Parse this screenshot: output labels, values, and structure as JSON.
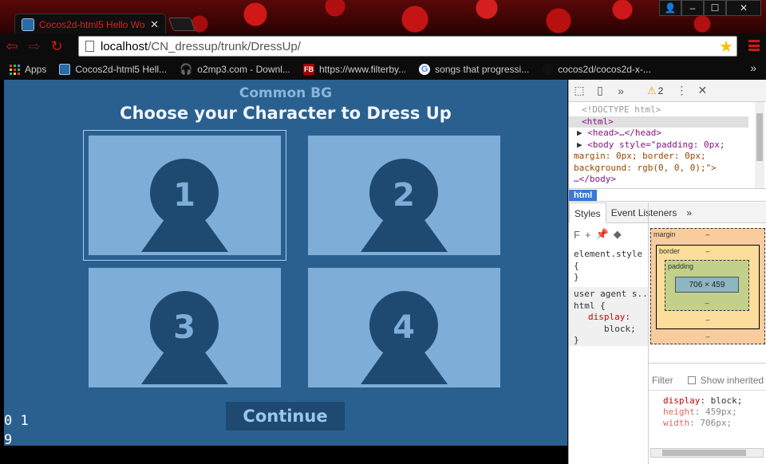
{
  "browser": {
    "tab": {
      "title": "Cocos2d-html5 Hello Wo"
    },
    "url": {
      "host": "localhost",
      "path": "/CN_dressup/trunk/DressUp/"
    },
    "bookmarks": [
      {
        "label": "Apps",
        "icon": "apps-grid-icon"
      },
      {
        "label": "Cocos2d-html5 Hell...",
        "icon": "cocos-icon"
      },
      {
        "label": "o2mp3.com - Downl...",
        "icon": "headphones-icon"
      },
      {
        "label": "https://www.filterby...",
        "icon": "fb-icon"
      },
      {
        "label": "songs that progressi...",
        "icon": "google-icon"
      },
      {
        "label": "cocos2d/cocos2d-x-...",
        "icon": "github-icon"
      }
    ],
    "bookmarks_more": "»"
  },
  "game": {
    "subtitle": "Common BG",
    "title": "Choose your Character to Dress Up",
    "characters": [
      {
        "number": "1",
        "selected": true
      },
      {
        "number": "2",
        "selected": false
      },
      {
        "number": "3",
        "selected": false
      },
      {
        "number": "4",
        "selected": false
      }
    ],
    "continue_label": "Continue",
    "fps_line1": "0 1",
    "fps_line2": "9"
  },
  "devtools": {
    "warning_count": "2",
    "more": "»",
    "dom": {
      "doctype": "<!DOCTYPE html>",
      "html_open": "<html>",
      "head": "<head>…</head>",
      "body_line1": "<body style=\"padding: 0px;",
      "body_line2": "margin: 0px; border: 0px;",
      "body_line3": "background: rgb(0, 0, 0);\">",
      "body_close": "…</body>"
    },
    "breadcrumb": "html",
    "tabs": [
      "Styles",
      "Event Listeners"
    ],
    "tabs_more": "»",
    "filter_letter": "F",
    "rules": {
      "element_style": "element.style",
      "open_brace": "{",
      "close_brace": "}",
      "ua_label": "user agent s...",
      "ua_selector": "html {",
      "ua_prop": "display",
      "ua_value": "block;"
    },
    "box_model": {
      "margin_label": "margin",
      "border_label": "border",
      "padding_label": "padding",
      "dash": "–",
      "content": "706 × 459"
    },
    "computed": {
      "filter_placeholder": "Filter",
      "show_inherited": "Show inherited",
      "props": [
        {
          "name": "display",
          "value": "block;",
          "dim": false
        },
        {
          "name": "height",
          "value": "459px;",
          "dim": true
        },
        {
          "name": "width",
          "value": "706px;",
          "dim": true
        }
      ]
    }
  },
  "colors": {
    "chrome_accent": "#d01818",
    "game_bg": "#2a6090",
    "card_bg": "#7eaed8",
    "silhouette": "#1e4a72"
  }
}
